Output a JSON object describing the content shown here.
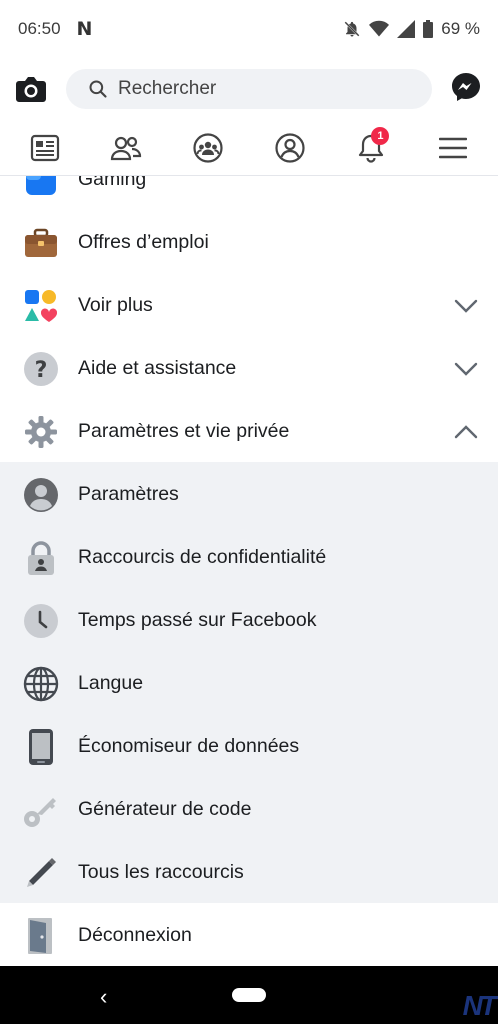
{
  "status": {
    "time": "06:50",
    "battery": "69 %",
    "app_letter": "N"
  },
  "search": {
    "placeholder": "Rechercher"
  },
  "tabs": [
    {
      "name": "news-feed",
      "badge": ""
    },
    {
      "name": "friends",
      "badge": ""
    },
    {
      "name": "groups",
      "badge": ""
    },
    {
      "name": "profile",
      "badge": ""
    },
    {
      "name": "notifications",
      "badge": "1"
    },
    {
      "name": "menu",
      "badge": ""
    }
  ],
  "menu": {
    "top_items": [
      {
        "label": "Gaming"
      },
      {
        "label": "Offres d’emploi"
      },
      {
        "label": "Voir plus"
      },
      {
        "label": "Aide et assistance"
      },
      {
        "label": "Paramètres et vie privée"
      }
    ],
    "sub_items": [
      {
        "label": "Paramètres"
      },
      {
        "label": "Raccourcis de confidentialité"
      },
      {
        "label": "Temps passé sur Facebook"
      },
      {
        "label": "Langue"
      },
      {
        "label": "Économiseur de données"
      },
      {
        "label": "Générateur de code"
      },
      {
        "label": "Tous les raccourcis"
      }
    ],
    "logout": {
      "label": "Déconnexion"
    }
  },
  "watermark": "NT",
  "colors": {
    "accent": "#1877f2",
    "band": "#f0f2f5",
    "badge": "#f02849"
  }
}
